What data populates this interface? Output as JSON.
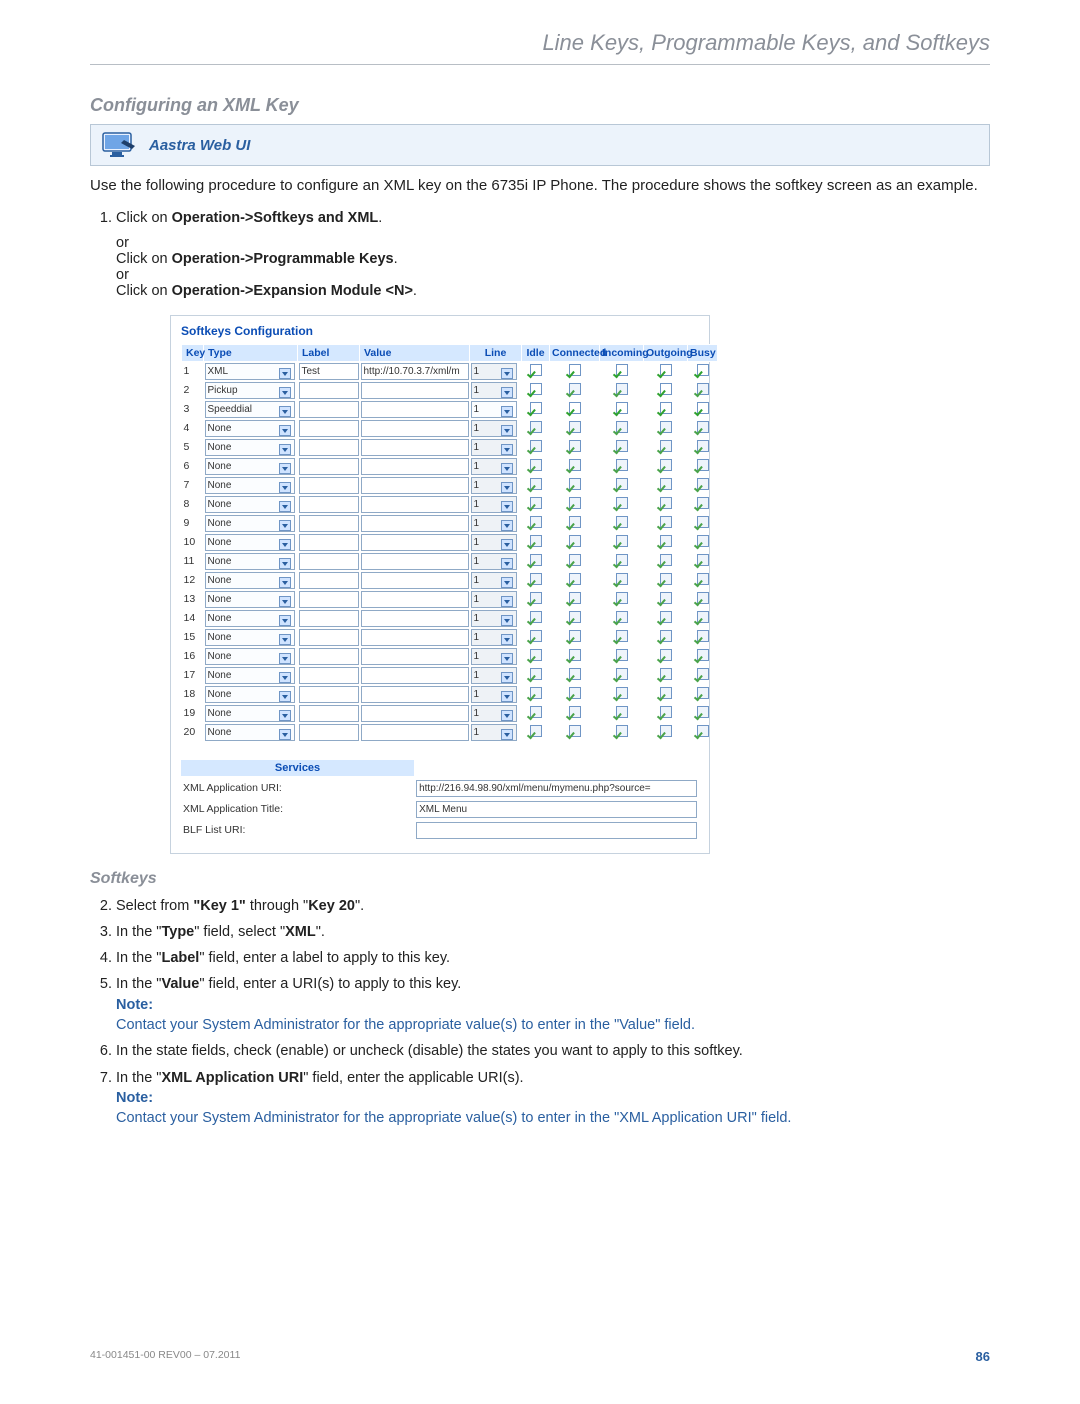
{
  "page_header": "Line Keys, Programmable Keys, and Softkeys",
  "section_title": "Configuring an XML Key",
  "webui_label": "Aastra Web UI",
  "intro": "Use the following procedure to configure an XML key on the 6735i IP Phone. The procedure shows the softkey screen as an example.",
  "step1a_pre": "Click on ",
  "step1a_bold": "Operation->Softkeys and XML",
  "step1a_post": ".",
  "or": "or",
  "step1b_pre": "Click on ",
  "step1b_bold": "Operation->Programmable Keys",
  "step1b_post": ".",
  "step1c_pre": "Click on ",
  "step1c_bold": "Operation->Expansion Module <N>",
  "step1c_post": ".",
  "shot": {
    "title": "Softkeys Configuration",
    "headers": [
      "Key",
      "Type",
      "Label",
      "Value",
      "Line",
      "Idle",
      "Connected",
      "Incoming",
      "Outgoing",
      "Busy"
    ],
    "rows": [
      {
        "key": "1",
        "type": "XML",
        "label": "Test",
        "value": "http://10.70.3.7/xml/m",
        "line": "1",
        "lineEnabled": false,
        "states": [
          "a",
          "a",
          "a",
          "a",
          "a"
        ]
      },
      {
        "key": "2",
        "type": "Pickup",
        "label": "",
        "value": "",
        "line": "1",
        "lineEnabled": false,
        "states": [
          "a",
          "d",
          "d",
          "a",
          "d"
        ]
      },
      {
        "key": "3",
        "type": "Speeddial",
        "label": "",
        "value": "",
        "line": "1",
        "lineEnabled": true,
        "states": [
          "a",
          "a",
          "a",
          "a",
          "a"
        ]
      },
      {
        "key": "4",
        "type": "None",
        "label": "",
        "value": "",
        "line": "1",
        "lineEnabled": false,
        "states": [
          "d",
          "d",
          "d",
          "d",
          "d"
        ]
      },
      {
        "key": "5",
        "type": "None",
        "label": "",
        "value": "",
        "line": "1",
        "lineEnabled": false,
        "states": [
          "d",
          "d",
          "d",
          "d",
          "d"
        ]
      },
      {
        "key": "6",
        "type": "None",
        "label": "",
        "value": "",
        "line": "1",
        "lineEnabled": false,
        "states": [
          "d",
          "d",
          "d",
          "d",
          "d"
        ]
      },
      {
        "key": "7",
        "type": "None",
        "label": "",
        "value": "",
        "line": "1",
        "lineEnabled": false,
        "states": [
          "d",
          "d",
          "d",
          "d",
          "d"
        ]
      },
      {
        "key": "8",
        "type": "None",
        "label": "",
        "value": "",
        "line": "1",
        "lineEnabled": false,
        "states": [
          "d",
          "d",
          "d",
          "d",
          "d"
        ]
      },
      {
        "key": "9",
        "type": "None",
        "label": "",
        "value": "",
        "line": "1",
        "lineEnabled": false,
        "states": [
          "d",
          "d",
          "d",
          "d",
          "d"
        ]
      },
      {
        "key": "10",
        "type": "None",
        "label": "",
        "value": "",
        "line": "1",
        "lineEnabled": false,
        "states": [
          "d",
          "d",
          "d",
          "d",
          "d"
        ]
      },
      {
        "key": "11",
        "type": "None",
        "label": "",
        "value": "",
        "line": "1",
        "lineEnabled": false,
        "states": [
          "d",
          "d",
          "d",
          "d",
          "d"
        ]
      },
      {
        "key": "12",
        "type": "None",
        "label": "",
        "value": "",
        "line": "1",
        "lineEnabled": false,
        "states": [
          "d",
          "d",
          "d",
          "d",
          "d"
        ]
      },
      {
        "key": "13",
        "type": "None",
        "label": "",
        "value": "",
        "line": "1",
        "lineEnabled": false,
        "states": [
          "d",
          "d",
          "d",
          "d",
          "d"
        ]
      },
      {
        "key": "14",
        "type": "None",
        "label": "",
        "value": "",
        "line": "1",
        "lineEnabled": false,
        "states": [
          "d",
          "d",
          "d",
          "d",
          "d"
        ]
      },
      {
        "key": "15",
        "type": "None",
        "label": "",
        "value": "",
        "line": "1",
        "lineEnabled": false,
        "states": [
          "d",
          "d",
          "d",
          "d",
          "d"
        ]
      },
      {
        "key": "16",
        "type": "None",
        "label": "",
        "value": "",
        "line": "1",
        "lineEnabled": false,
        "states": [
          "d",
          "d",
          "d",
          "d",
          "d"
        ]
      },
      {
        "key": "17",
        "type": "None",
        "label": "",
        "value": "",
        "line": "1",
        "lineEnabled": false,
        "states": [
          "d",
          "d",
          "d",
          "d",
          "d"
        ]
      },
      {
        "key": "18",
        "type": "None",
        "label": "",
        "value": "",
        "line": "1",
        "lineEnabled": false,
        "states": [
          "d",
          "d",
          "d",
          "d",
          "d"
        ]
      },
      {
        "key": "19",
        "type": "None",
        "label": "",
        "value": "",
        "line": "1",
        "lineEnabled": false,
        "states": [
          "d",
          "d",
          "d",
          "d",
          "d"
        ]
      },
      {
        "key": "20",
        "type": "None",
        "label": "",
        "value": "",
        "line": "1",
        "lineEnabled": false,
        "states": [
          "d",
          "d",
          "d",
          "d",
          "d"
        ]
      }
    ],
    "services_title": "Services",
    "svc": {
      "uri_label": "XML Application URI:",
      "uri_value": "http://216.94.98.90/xml/menu/mymenu.php?source=",
      "title_label": "XML Application Title:",
      "title_value": "XML Menu",
      "blf_label": "BLF List URI:",
      "blf_value": ""
    }
  },
  "softkeys_title": "Softkeys",
  "steps2": [
    {
      "n": "2.",
      "parts": [
        "Select from ",
        "\"Key 1\"",
        " through \"",
        "Key 20",
        "\"."
      ]
    },
    {
      "n": "3.",
      "parts": [
        "In the \"",
        "Type",
        "\" field, select \"",
        "XML",
        "\"."
      ]
    },
    {
      "n": "4.",
      "parts": [
        "In the \"",
        "Label",
        "\" field, enter a label to apply to this key."
      ]
    },
    {
      "n": "5.",
      "parts": [
        "In the \"",
        "Value",
        "\" field, enter a URI(s) to apply to this key."
      ],
      "note": "Contact your System Administrator for the appropriate value(s) to enter in the \"Value\" field."
    },
    {
      "n": "6.",
      "parts": [
        "In the state fields, check (enable) or uncheck (disable) the states you want to apply to this softkey."
      ]
    },
    {
      "n": "7.",
      "parts": [
        "In the \"",
        "XML Application URI",
        "\" field, enter the applicable URI(s)."
      ],
      "note": "Contact your System Administrator for the appropriate value(s) to enter in the \"XML Application URI\" field."
    }
  ],
  "note_label": "Note:",
  "footer": {
    "docnum": "41-001451-00 REV00 – 07.2011",
    "page": "86"
  }
}
